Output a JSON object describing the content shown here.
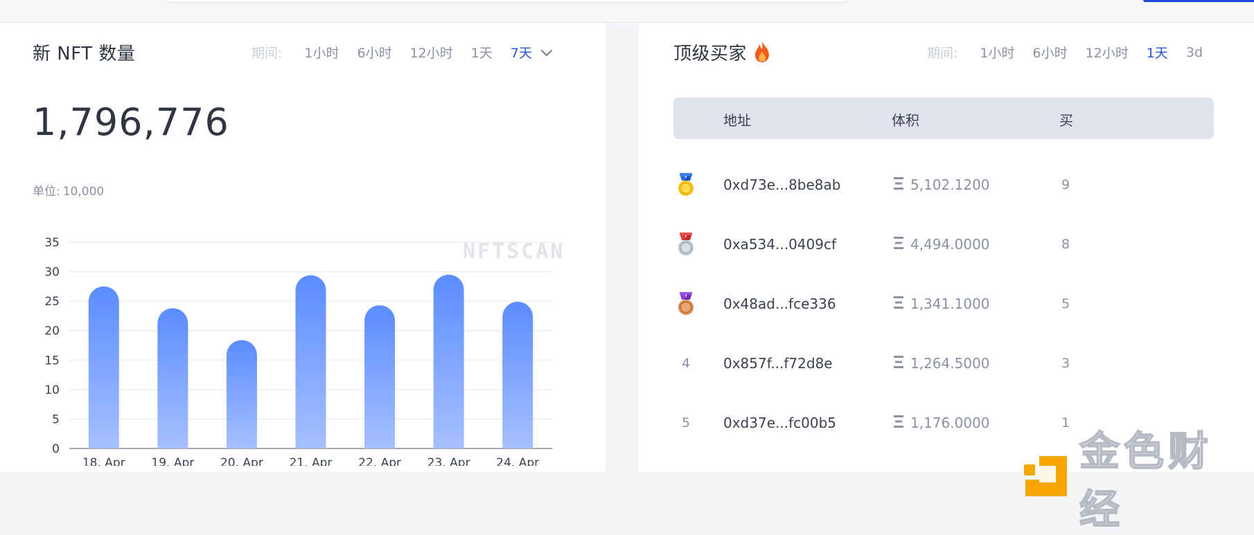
{
  "left_panel": {
    "title": "新 NFT 数量",
    "period_label": "期间:",
    "periods": [
      "1小时",
      "6小时",
      "12小时",
      "1天",
      "7天"
    ],
    "active_period": "7天",
    "total": "1,796,776",
    "unit_label": "单位:",
    "unit_value": "10,000",
    "watermark": "NFTSCAN"
  },
  "right_panel": {
    "title": "顶级买家",
    "period_label": "期间:",
    "periods": [
      "1小时",
      "6小时",
      "12小时",
      "1天",
      "3d"
    ],
    "active_period": "1天",
    "table": {
      "headers": [
        "地址",
        "体积",
        "买"
      ],
      "rows": [
        {
          "rank": "1",
          "rank_icon": "gold-medal-icon",
          "address": "0xd73e...8be8ab",
          "volume": "5,102.1200",
          "buys": "9"
        },
        {
          "rank": "2",
          "rank_icon": "silver-medal-icon",
          "address": "0xa534...0409cf",
          "volume": "4,494.0000",
          "buys": "8"
        },
        {
          "rank": "3",
          "rank_icon": "bronze-medal-icon",
          "address": "0x48ad...fce336",
          "volume": "1,341.1000",
          "buys": "5"
        },
        {
          "rank": "4",
          "rank_icon": "",
          "address": "0x857f...f72d8e",
          "volume": "1,264.5000",
          "buys": "3"
        },
        {
          "rank": "5",
          "rank_icon": "",
          "address": "0xd37e...fc00b5",
          "volume": "1,176.0000",
          "buys": "1"
        }
      ]
    }
  },
  "overlay_logo": {
    "text": "金色财经",
    "icon": "jinse-logo-icon"
  },
  "colors": {
    "accent": "#2b55d9",
    "bar_top": "#5b8cff",
    "bar_bottom": "#a6c0ff",
    "header_bg": "#dfe3ee"
  },
  "chart_data": {
    "type": "bar",
    "categories": [
      "18. Apr",
      "19. Apr",
      "20. Apr",
      "21. Apr",
      "22. Apr",
      "23. Apr",
      "24. Apr"
    ],
    "values": [
      27.5,
      23.8,
      18.4,
      29.4,
      24.3,
      29.5,
      24.9
    ],
    "ylim": [
      0,
      35
    ],
    "yticks": [
      0,
      5,
      10,
      15,
      20,
      25,
      30,
      35
    ],
    "grid": true,
    "title": "",
    "xlabel": "",
    "ylabel": ""
  }
}
